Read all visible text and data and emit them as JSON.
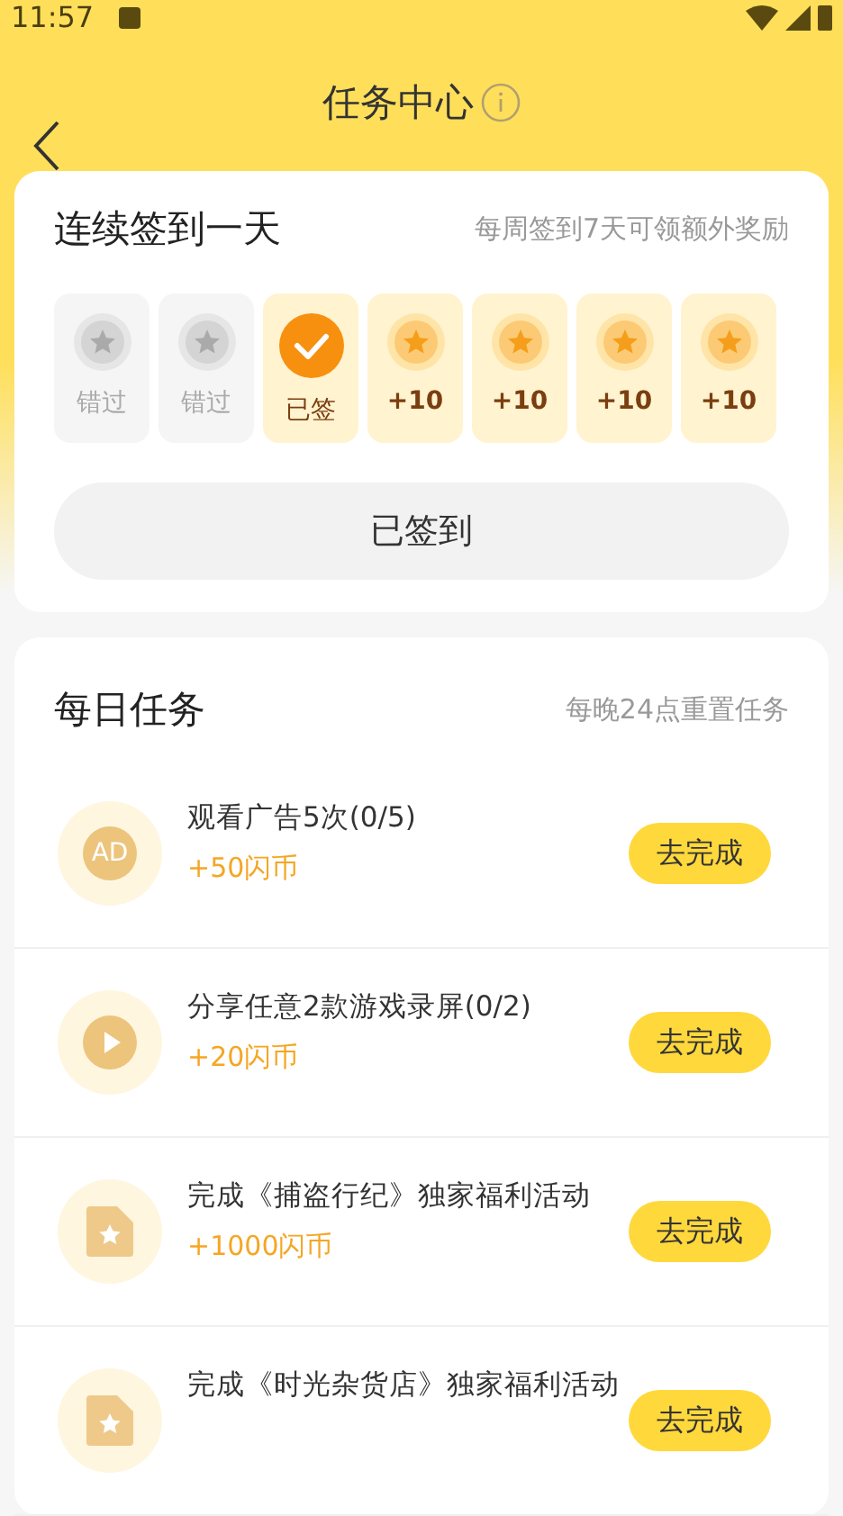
{
  "status_bar": {
    "time": "11:57"
  },
  "header": {
    "title": "任务中心"
  },
  "checkin": {
    "title": "连续签到一天",
    "hint": "每周签到7天可领额外奖励",
    "days": [
      {
        "kind": "missed",
        "label": "错过"
      },
      {
        "kind": "missed",
        "label": "错过"
      },
      {
        "kind": "signed",
        "label": "已签"
      },
      {
        "kind": "upcoming",
        "label": "+10"
      },
      {
        "kind": "upcoming",
        "label": "+10"
      },
      {
        "kind": "upcoming",
        "label": "+10"
      },
      {
        "kind": "upcoming",
        "label": "+10"
      }
    ],
    "button": {
      "label": "已签到",
      "disabled": true
    }
  },
  "daily": {
    "title": "每日任务",
    "hint": "每晚24点重置任务",
    "tasks": [
      {
        "kind": "ad",
        "icon_text": "AD",
        "title": "观看广告5次(0/5)",
        "reward": "+50闪币",
        "button": "去完成"
      },
      {
        "kind": "video",
        "title": "分享任意2款游戏录屏(0/2)",
        "reward": "+20闪币",
        "button": "去完成"
      },
      {
        "kind": "activity",
        "title": "完成《捕盗行纪》独家福利活动",
        "reward": "+1000闪币",
        "button": "去完成"
      },
      {
        "kind": "activity",
        "title": "完成《时光杂货店》独家福利活动",
        "button": "去完成"
      }
    ]
  }
}
